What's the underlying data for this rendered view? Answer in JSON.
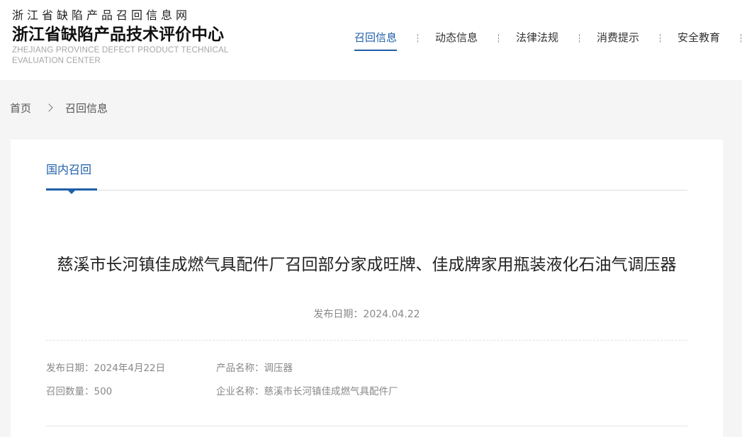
{
  "header": {
    "site_top": "浙江省缺陷产品召回信息网",
    "site_main": "浙江省缺陷产品技术评价中心",
    "site_en": "ZHEJIANG PROVINCE DEFECT PRODUCT TECHNICAL EVALUATION CENTER"
  },
  "nav": {
    "items": [
      {
        "label": "召回信息",
        "active": true
      },
      {
        "label": "动态信息",
        "active": false
      },
      {
        "label": "法律法规",
        "active": false
      },
      {
        "label": "消费提示",
        "active": false
      },
      {
        "label": "安全教育",
        "active": false
      }
    ]
  },
  "breadcrumb": {
    "home": "首页",
    "separator_icon": "chevron-right-icon",
    "current": "召回信息"
  },
  "tab": {
    "label": "国内召回"
  },
  "article": {
    "title": "慈溪市长河镇佳成燃气具配件厂召回部分家成旺牌、佳成牌家用瓶装液化石油气调压器",
    "date": "发布日期：2024.04.22",
    "meta": {
      "publish_date": "发布日期：2024年4月22日",
      "product_name": "产品名称：调压器",
      "recall_count": "召回数量：500",
      "company_name": "企业名称：慈溪市长河镇佳成燃气具配件厂"
    }
  },
  "colors": {
    "accent": "#1f5fa8",
    "background": "#f5f5f5"
  }
}
